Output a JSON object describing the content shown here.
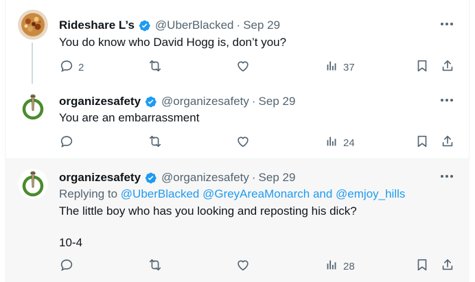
{
  "tweets": [
    {
      "display_name": "Rideshare L’s",
      "handle": "@UberBlacked",
      "separator": "·",
      "date": "Sep 29",
      "text": "You do know who David Hogg is, don’t you?",
      "replies": "2",
      "views": "37"
    },
    {
      "display_name": "organizesafety",
      "handle": "@organizesafety",
      "separator": "·",
      "date": "Sep 29",
      "text": "You are an embarrassment",
      "replies": "",
      "views": "24"
    },
    {
      "display_name": "organizesafety",
      "handle": "@organizesafety",
      "separator": "·",
      "date": "Sep 29",
      "replying_prefix": "Replying to ",
      "replying_links": "@UberBlacked @GreyAreaMonarch and @emjoy_hills",
      "text": "The little boy who has you looking and reposting his dick?",
      "text2": "10-4",
      "replies": "",
      "views": "28"
    }
  ],
  "colors": {
    "verified_blue": "#1d9bf0",
    "muted_text": "#536471",
    "highlight_bg": "#f7f7f7"
  },
  "icons": [
    "reply-icon",
    "retweet-icon",
    "like-icon",
    "views-icon",
    "bookmark-icon",
    "share-icon",
    "more-icon",
    "verified-badge-icon"
  ]
}
